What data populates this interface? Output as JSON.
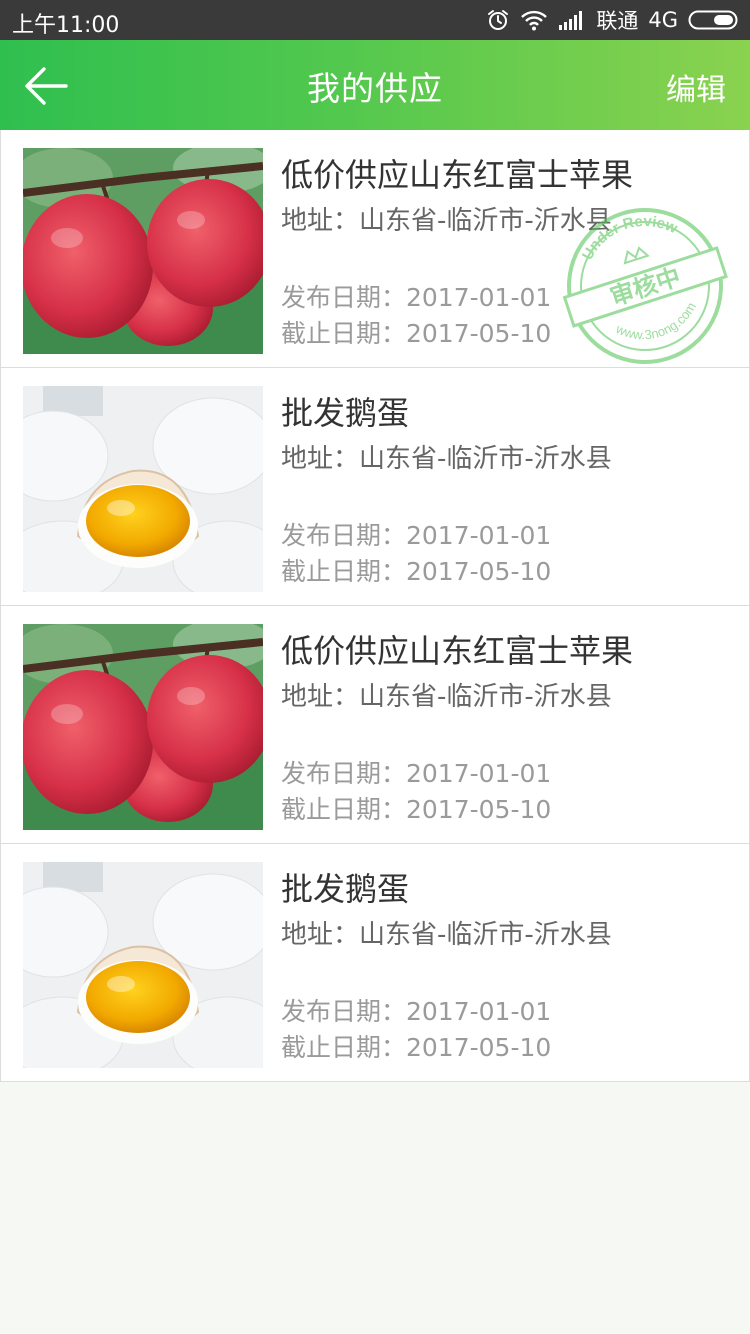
{
  "status_bar": {
    "time": "上午11:00",
    "carrier": "联通",
    "network": "4G",
    "icons": [
      "alarm-icon",
      "wifi-icon",
      "signal-icon",
      "battery-icon"
    ]
  },
  "header": {
    "title": "我的供应",
    "edit_label": "编辑",
    "back_icon": "arrow-left-icon"
  },
  "colors": {
    "header_start": "#2fbf4f",
    "header_end": "#8ad24f",
    "stamp": "#4cc24f"
  },
  "items": [
    {
      "title": "低价供应山东红富士苹果",
      "address": "地址：山东省-临沂市-沂水县",
      "publish": "发布日期：2017-01-01",
      "deadline": "截止日期：2017-05-10",
      "image": "apples",
      "stamp": {
        "main": "审核中",
        "top": "Under Review",
        "bottom": "www.3nong.com"
      }
    },
    {
      "title": "批发鹅蛋",
      "address": "地址：山东省-临沂市-沂水县",
      "publish": "发布日期：2017-01-01",
      "deadline": "截止日期：2017-05-10",
      "image": "goose-eggs"
    },
    {
      "title": "低价供应山东红富士苹果",
      "address": "地址：山东省-临沂市-沂水县",
      "publish": "发布日期：2017-01-01",
      "deadline": "截止日期：2017-05-10",
      "image": "apples"
    },
    {
      "title": "批发鹅蛋",
      "address": "地址：山东省-临沂市-沂水县",
      "publish": "发布日期：2017-01-01",
      "deadline": "截止日期：2017-05-10",
      "image": "goose-eggs"
    }
  ]
}
